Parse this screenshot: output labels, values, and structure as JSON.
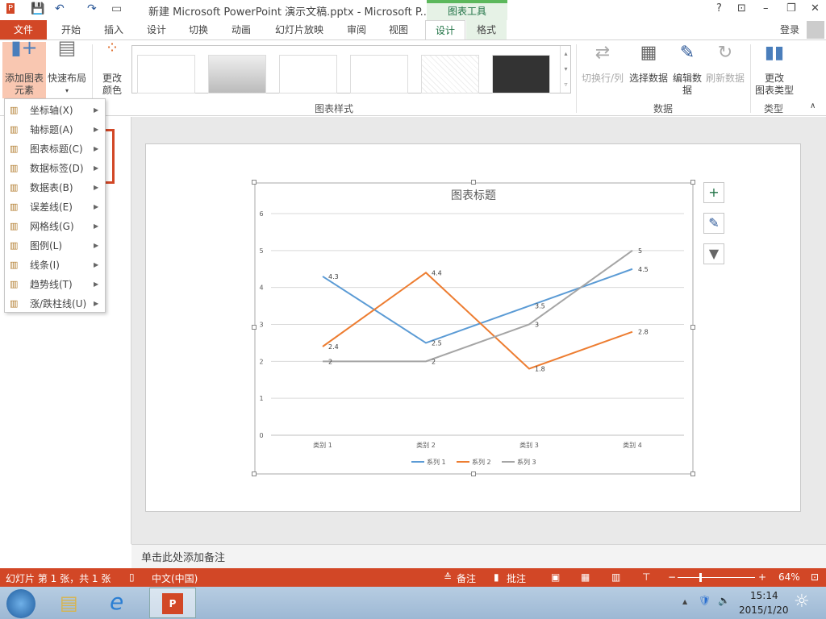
{
  "title": "新建 Microsoft PowerPoint 演示文稿.pptx - Microsoft P...",
  "context_tab": "图表工具",
  "window_buttons": [
    "?",
    "⊡",
    "–",
    "❐",
    "✕"
  ],
  "tabs": [
    "文件",
    "开始",
    "插入",
    "设计",
    "切换",
    "动画",
    "幻灯片放映",
    "审阅",
    "视图",
    "设计",
    "格式"
  ],
  "signin": "登录",
  "ribbon": {
    "add_element": "添加图表元素",
    "add_element_l1": "添加图表",
    "add_element_l2": "元素",
    "quick_layout": "快速布局",
    "change_color_l1": "更改",
    "change_color_l2": "颜色",
    "styles_group": "图表样式",
    "switch_row_col": "切换行/列",
    "select_data": "选择数据",
    "edit_data_l1": "编辑数",
    "edit_data_l2": "据",
    "refresh_data": "刷新数据",
    "data_group": "数据",
    "change_type_l1": "更改",
    "change_type_l2": "图表类型",
    "type_group": "类型"
  },
  "menu": [
    {
      "label": "坐标轴(X)",
      "icon": "axes-icon"
    },
    {
      "label": "轴标题(A)",
      "icon": "axis-title-icon"
    },
    {
      "label": "图表标题(C)",
      "icon": "chart-title-icon"
    },
    {
      "label": "数据标签(D)",
      "icon": "data-labels-icon"
    },
    {
      "label": "数据表(B)",
      "icon": "data-table-icon"
    },
    {
      "label": "误差线(E)",
      "icon": "error-bars-icon"
    },
    {
      "label": "网格线(G)",
      "icon": "gridlines-icon"
    },
    {
      "label": "图例(L)",
      "icon": "legend-icon"
    },
    {
      "label": "线条(I)",
      "icon": "lines-icon"
    },
    {
      "label": "趋势线(T)",
      "icon": "trendline-icon"
    },
    {
      "label": "涨/跌柱线(U)",
      "icon": "up-down-bars-icon"
    }
  ],
  "notes_placeholder": "单击此处添加备注",
  "status": {
    "slide": "幻灯片 第 1 张，共 1 张",
    "lang": "中文(中国)",
    "notes": "备注",
    "comments": "批注",
    "zoom": "64%"
  },
  "clock": {
    "time": "15:14",
    "date": "2015/1/20"
  },
  "chart_data": {
    "type": "line",
    "title": "图表标题",
    "categories": [
      "类别 1",
      "类别 2",
      "类别 3",
      "类别 4"
    ],
    "yticks": [
      "0",
      "1",
      "2",
      "3",
      "4",
      "5",
      "6"
    ],
    "ylim": [
      0,
      6
    ],
    "legend_position": "bottom",
    "series": [
      {
        "name": "系列 1",
        "values": [
          4.3,
          2.5,
          3.5,
          4.5
        ],
        "color": "#5b9bd5"
      },
      {
        "name": "系列 2",
        "values": [
          2.4,
          4.4,
          1.8,
          2.8
        ],
        "color": "#ed7d31"
      },
      {
        "name": "系列 3",
        "values": [
          2,
          2,
          3,
          5
        ],
        "color": "#a5a5a5"
      }
    ]
  }
}
